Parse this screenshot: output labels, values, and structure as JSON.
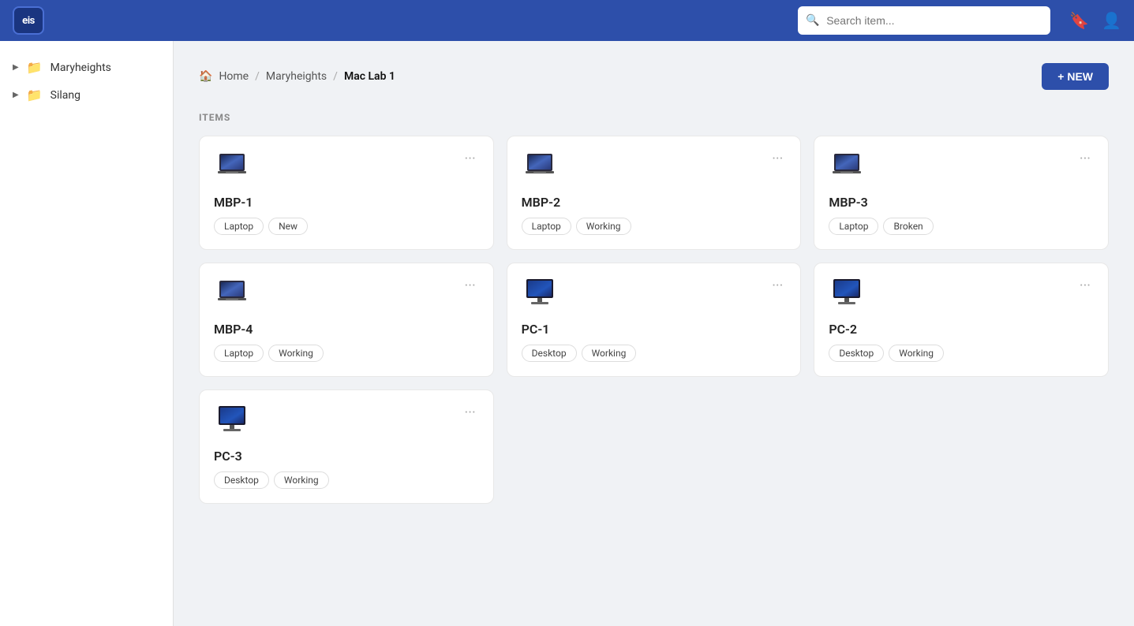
{
  "header": {
    "logo_text": "eis",
    "search_placeholder": "Search item..."
  },
  "sidebar": {
    "items": [
      {
        "id": "maryheights",
        "label": "Maryheights"
      },
      {
        "id": "silang",
        "label": "Silang"
      }
    ]
  },
  "breadcrumb": {
    "home_label": "Home",
    "crumbs": [
      "Maryheights",
      "Mac Lab 1"
    ]
  },
  "new_button_label": "+ NEW",
  "section_label": "ITEMS",
  "items": [
    {
      "id": "mbp-1",
      "name": "MBP-1",
      "type": "laptop",
      "tags": [
        "Laptop",
        "New"
      ]
    },
    {
      "id": "mbp-2",
      "name": "MBP-2",
      "type": "laptop",
      "tags": [
        "Laptop",
        "Working"
      ]
    },
    {
      "id": "mbp-3",
      "name": "MBP-3",
      "type": "laptop",
      "tags": [
        "Laptop",
        "Broken"
      ]
    },
    {
      "id": "mbp-4",
      "name": "MBP-4",
      "type": "laptop",
      "tags": [
        "Laptop",
        "Working"
      ]
    },
    {
      "id": "pc-1",
      "name": "PC-1",
      "type": "desktop",
      "tags": [
        "Desktop",
        "Working"
      ]
    },
    {
      "id": "pc-2",
      "name": "PC-2",
      "type": "desktop",
      "tags": [
        "Desktop",
        "Working"
      ]
    },
    {
      "id": "pc-3",
      "name": "PC-3",
      "type": "desktop",
      "tags": [
        "Desktop",
        "Working"
      ]
    }
  ]
}
